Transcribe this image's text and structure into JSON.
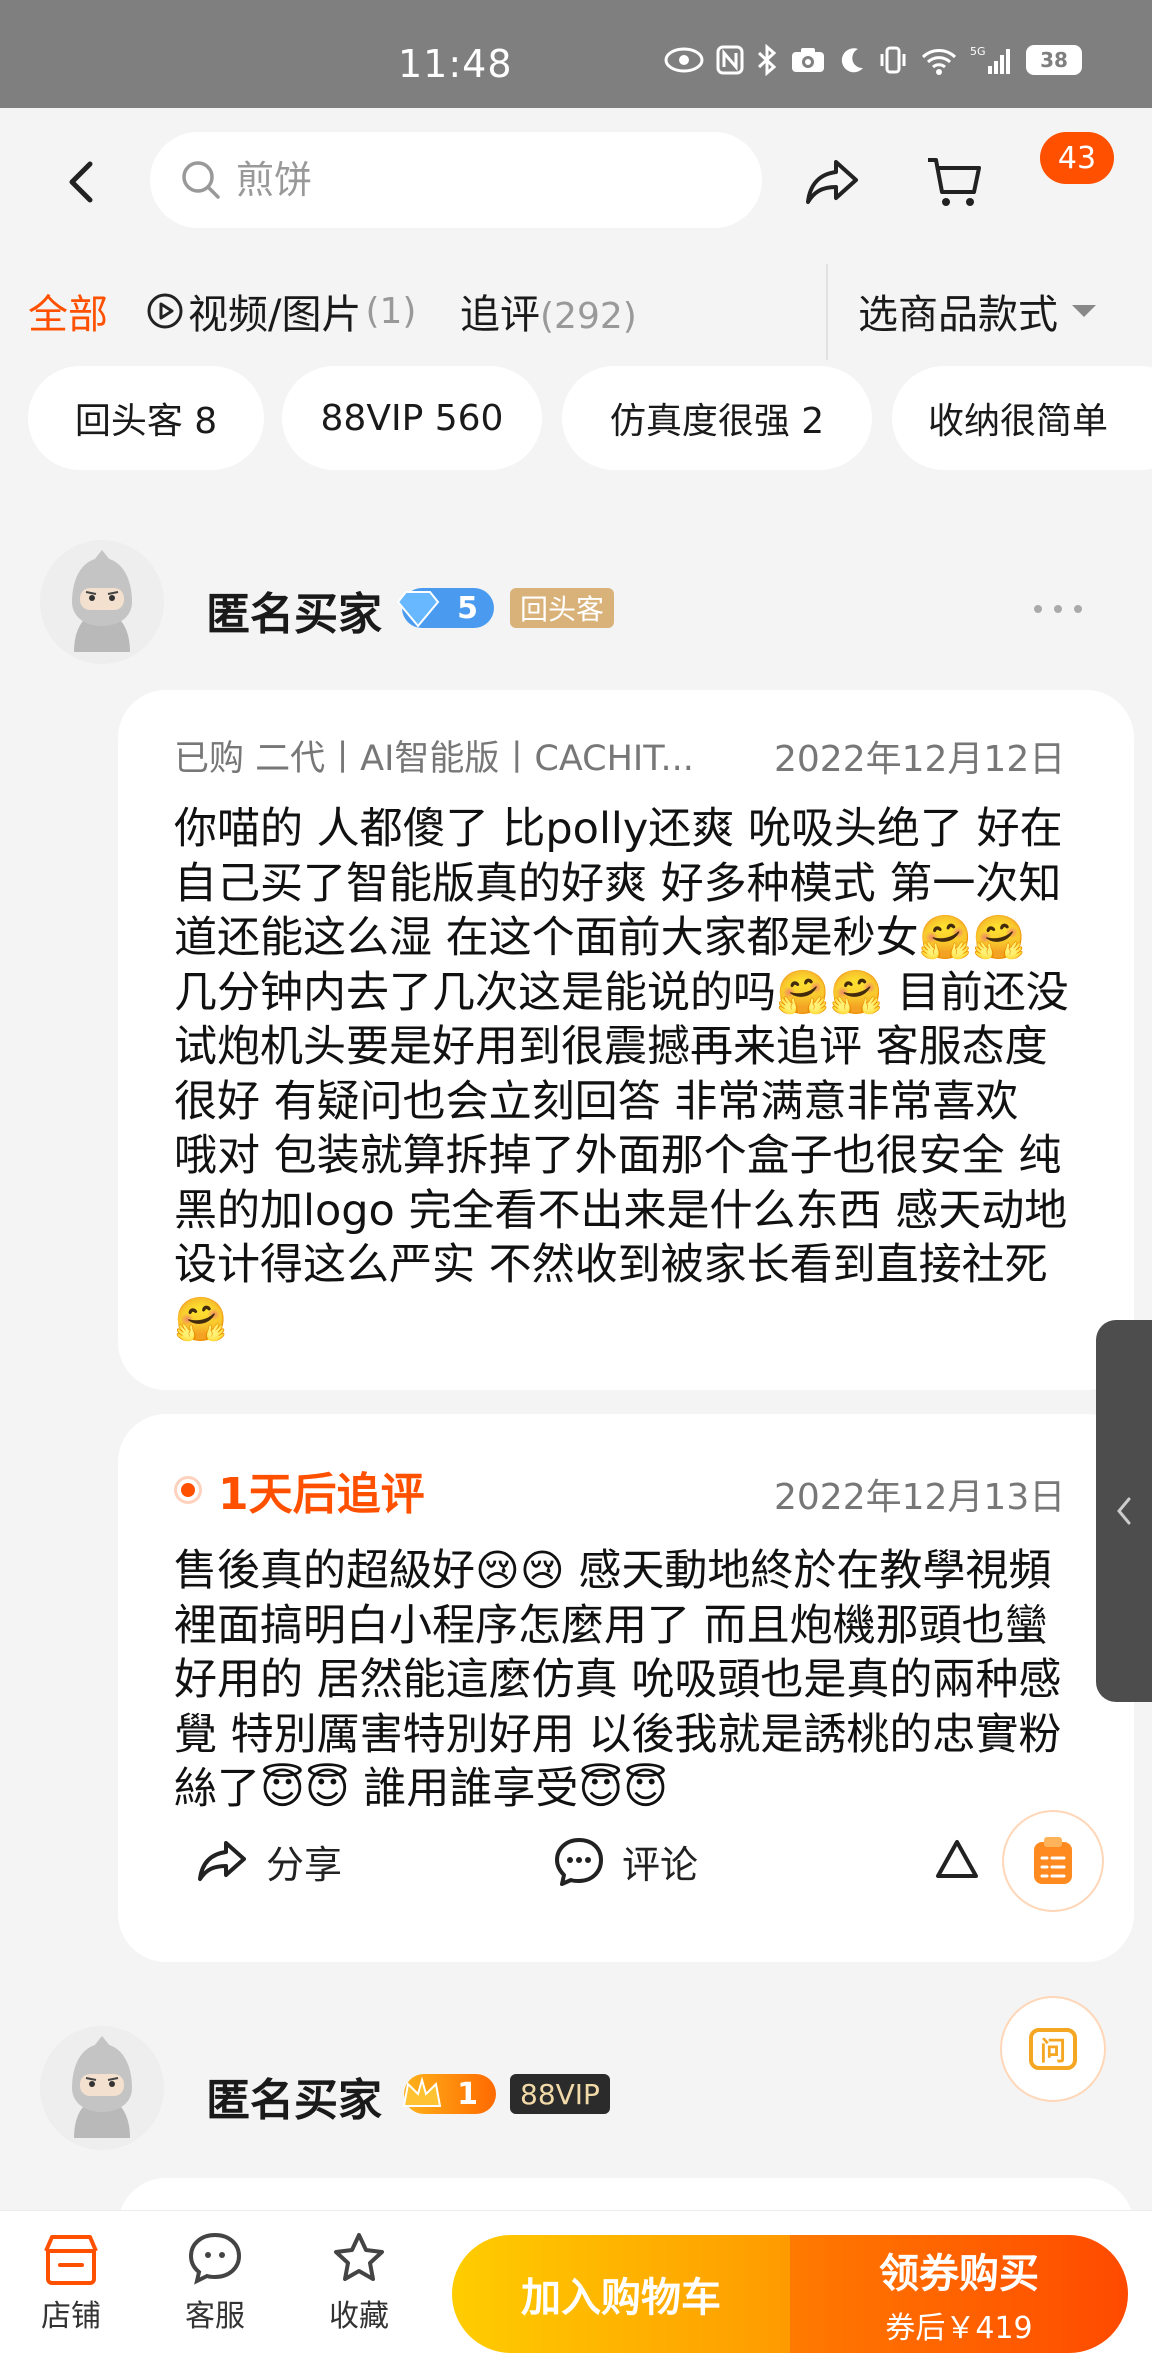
{
  "status_bar": {
    "time": "11:48",
    "network": "5G",
    "battery": "38"
  },
  "search": {
    "placeholder": "煎饼"
  },
  "cart": {
    "badge": "43"
  },
  "tabs": {
    "all": "全部",
    "media_label": "视频/图片",
    "media_count": "(1)",
    "followup_label": "追评",
    "followup_count": "(292)",
    "style_select": "选商品款式"
  },
  "chips": [
    {
      "label": "回头客  8"
    },
    {
      "label": "88VIP  560"
    },
    {
      "label": "仿真度很强  2"
    },
    {
      "label": "收纳很简单"
    }
  ],
  "review1": {
    "username": "匿名买家",
    "level": "5",
    "tag": "回头客",
    "purchase": "已购  二代丨AI智能版丨CACHIT...",
    "date": "2022年12月12日",
    "text": "你喵的 人都傻了 比polly还爽 吮吸头绝了 好在自己买了智能版真的好爽 好多种模式 第一次知道还能这么湿 在这个面前大家都是秒女🤗🤗 几分钟内去了几次这是能说的吗🤗🤗 目前还没试炮机头要是好用到很震撼再来追评 客服态度很好 有疑问也会立刻回答 非常满意非常喜欢 哦对 包装就算拆掉了外面那个盒子也很安全 纯黑的加logo 完全看不出来是什么东西 感天动地设计得这么严实 不然收到被家长看到直接社死🤗",
    "followup_title": "1天后追评",
    "followup_date": "2022年12月13日",
    "followup_text": "售後真的超級好😢😢 感天動地終於在教學視頻裡面搞明白小程序怎麼用了 而且炮機那頭也蠻好用的 居然能這麼仿真 吮吸頭也是真的兩种感覺 特別厲害特別好用 以後我就是誘桃的忠實粉絲了😇😇 誰用誰享受😇😇",
    "actions": {
      "share": "分享",
      "comment": "评论"
    }
  },
  "review2": {
    "username": "匿名买家",
    "level": "1",
    "tag": "88VIP"
  },
  "float": {
    "ask": "问"
  },
  "bottom_bar": {
    "shop": "店铺",
    "service": "客服",
    "favorite": "收藏",
    "add_to_cart": "加入购物车",
    "buy": "领券购买",
    "buy_sub": "券后￥419"
  },
  "colors": {
    "accent": "#ff5000",
    "cta_yellow": "#ffb800",
    "cta_orange": "#ff5a00"
  }
}
